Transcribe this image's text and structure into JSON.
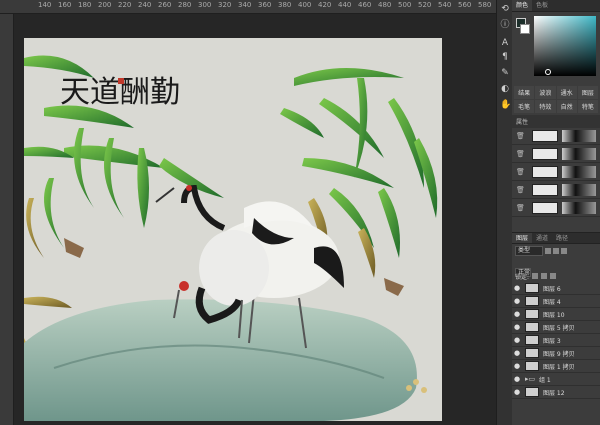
{
  "ruler": {
    "ticks": [
      "140",
      "160",
      "180",
      "200",
      "220",
      "240",
      "260",
      "280",
      "300",
      "320",
      "340",
      "360",
      "380",
      "400",
      "420",
      "440",
      "460",
      "480",
      "500",
      "520",
      "540",
      "560",
      "580"
    ]
  },
  "artwork": {
    "calligraphy": "天道酬勤",
    "seal_text": "天道酬勤",
    "accent_colors": {
      "bamboo": "#3e9a3a",
      "crane_crown": "#c8302a",
      "rock": "#a7c8b9"
    }
  },
  "color_panel": {
    "tabs": [
      "颜色",
      "色板"
    ]
  },
  "adjust_panel": {
    "cells": [
      "结果",
      "波浪",
      "通水",
      "图层",
      "毛笔",
      "特效",
      "自然",
      "特笔"
    ]
  },
  "props_panel": {
    "header": "属性"
  },
  "layers_panel": {
    "tabs": [
      "图层",
      "通道",
      "路径"
    ],
    "filter": "类型",
    "blend": "正常",
    "lock_label": "锁定:",
    "layers": [
      {
        "name": "图层 6"
      },
      {
        "name": "图层 4"
      },
      {
        "name": "图层 10"
      },
      {
        "name": "图层 5 拷贝"
      },
      {
        "name": "图层 3"
      },
      {
        "name": "图层 9 拷贝"
      },
      {
        "name": "图层 1 拷贝"
      },
      {
        "name": "组 1",
        "folder": true
      },
      {
        "name": "图层 12"
      }
    ]
  },
  "toolstrip": {
    "icons": [
      "history-icon",
      "info-icon",
      "type-icon",
      "paragraph-icon",
      "brush-preset-icon",
      "adjust-icon",
      "hand-icon"
    ]
  }
}
